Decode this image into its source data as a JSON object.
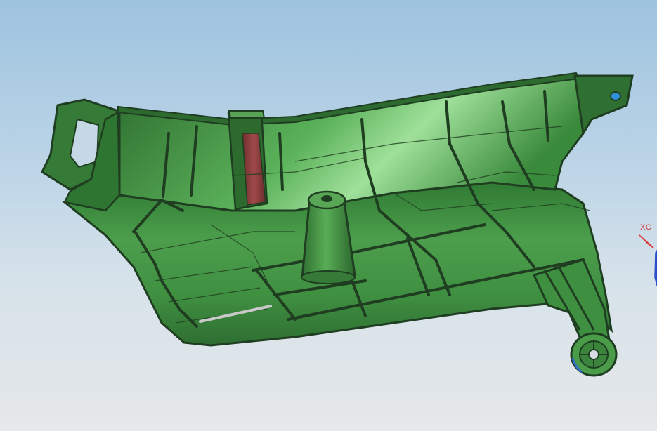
{
  "viewport": {
    "background_top": "#9ec3df",
    "background_bottom": "#e6e8ea"
  },
  "model": {
    "name": "",
    "body_color": "#3f8f41",
    "edge_color": "#1f3d20",
    "highlight_color": "#7fd07a",
    "accent_color": "#8a3a3a"
  },
  "triad": {
    "x_axis_label": "XC",
    "x_axis_color": "#d83a3a",
    "z_axis_color": "#2a4fc8"
  }
}
